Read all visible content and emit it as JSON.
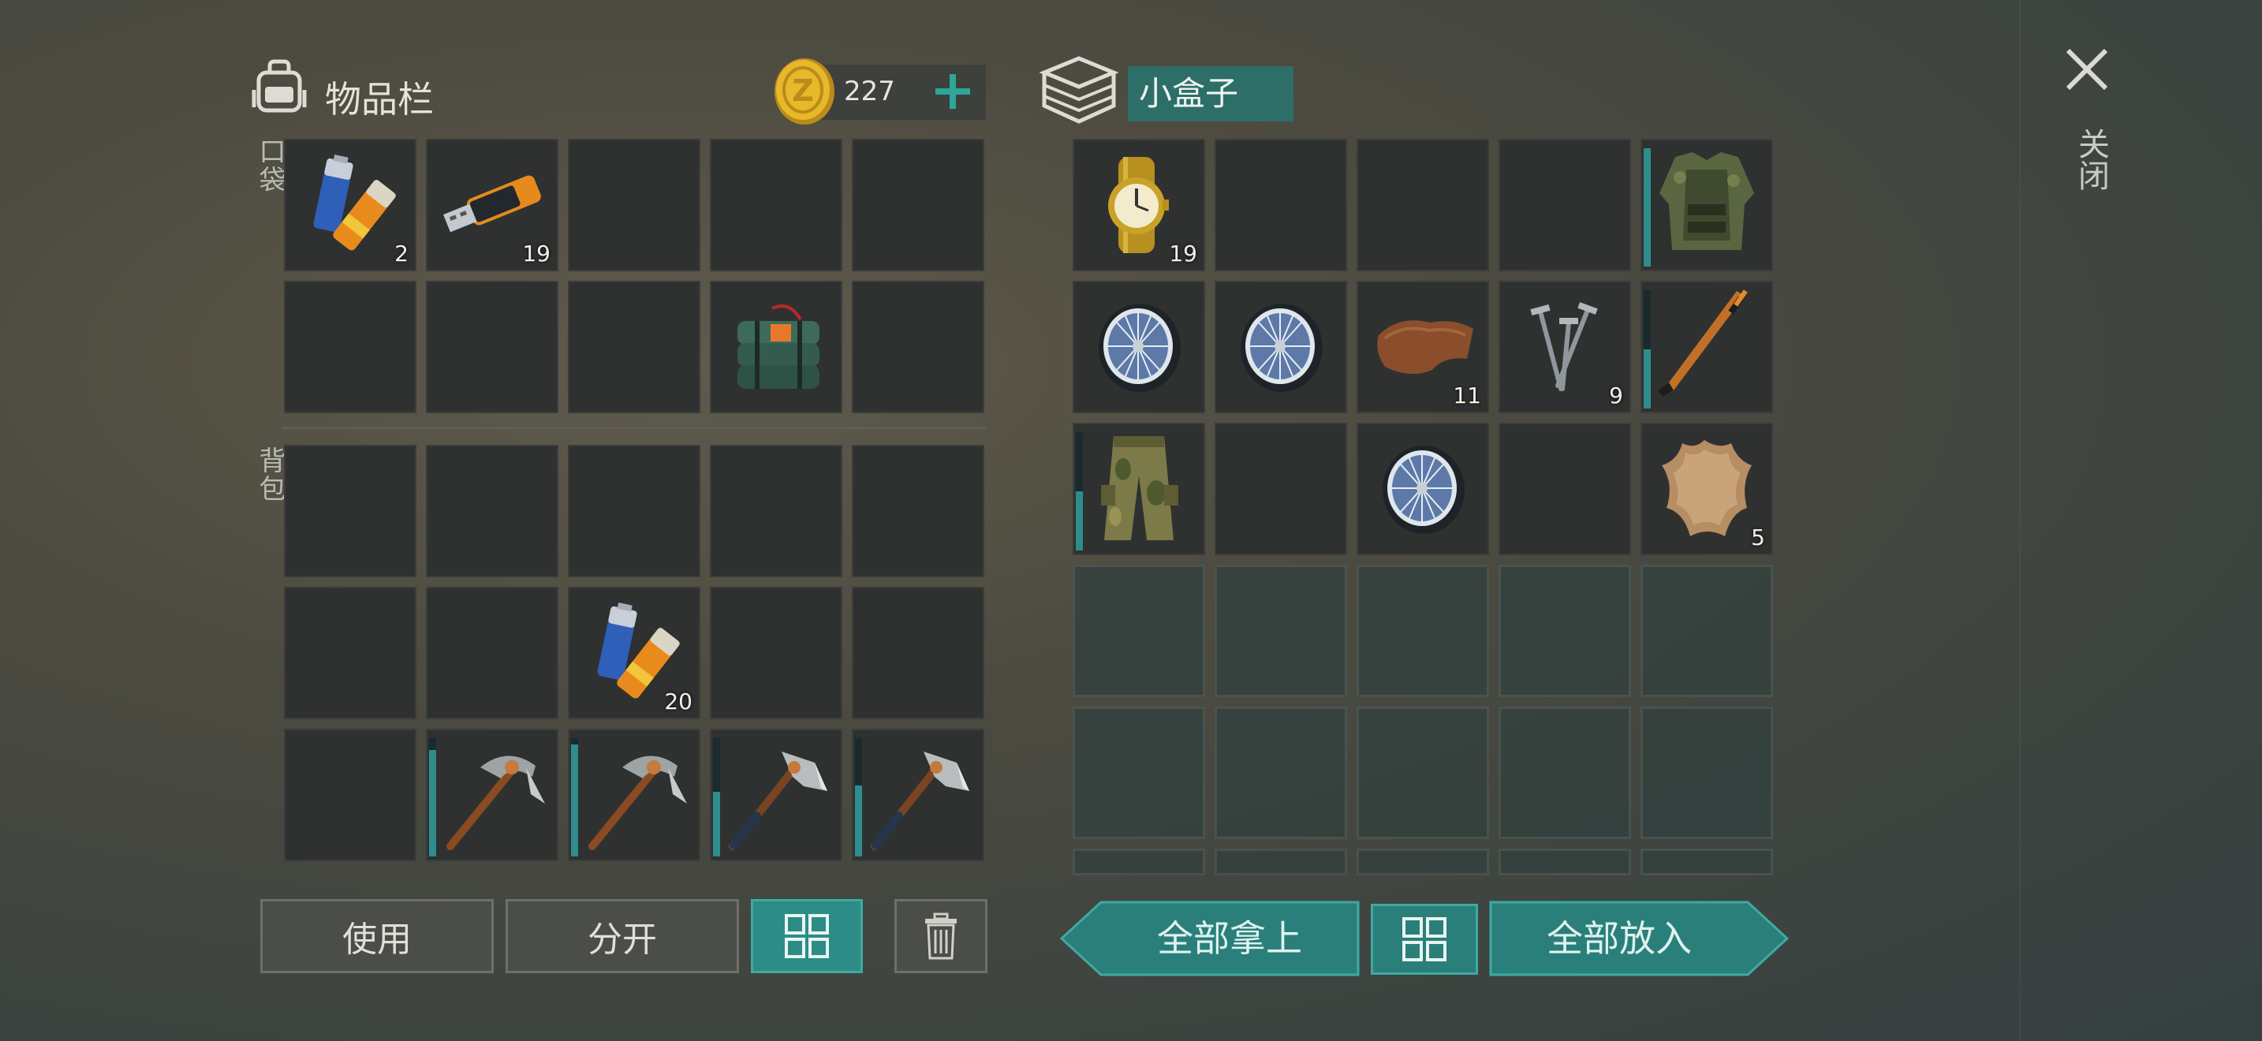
{
  "inventory": {
    "title": "物品栏",
    "coins": "227",
    "section_pockets": "口袋",
    "section_backpack": "背包",
    "pocket_slots": [
      {
        "item": "batteries-icon",
        "count": "2"
      },
      {
        "item": "usb-drive-icon",
        "count": "19"
      },
      {
        "item": "",
        "count": ""
      },
      {
        "item": "",
        "count": ""
      },
      {
        "item": "",
        "count": ""
      },
      {
        "item": "",
        "count": ""
      },
      {
        "item": "",
        "count": ""
      },
      {
        "item": "",
        "count": ""
      },
      {
        "item": "explosive-charge-icon",
        "count": ""
      },
      {
        "item": "",
        "count": ""
      }
    ],
    "backpack_slots": [
      {
        "item": "",
        "count": ""
      },
      {
        "item": "",
        "count": ""
      },
      {
        "item": "",
        "count": ""
      },
      {
        "item": "",
        "count": ""
      },
      {
        "item": "",
        "count": ""
      },
      {
        "item": "",
        "count": ""
      },
      {
        "item": "",
        "count": ""
      },
      {
        "item": "batteries-icon",
        "count": "20"
      },
      {
        "item": "",
        "count": ""
      },
      {
        "item": "",
        "count": ""
      },
      {
        "item": "",
        "count": ""
      },
      {
        "item": "pickaxe-icon",
        "count": "",
        "durability": 0.9
      },
      {
        "item": "pickaxe-icon",
        "count": "",
        "durability": 0.95
      },
      {
        "item": "hatchet-icon",
        "count": "",
        "durability": 0.55
      },
      {
        "item": "hatchet-icon",
        "count": "",
        "durability": 0.6
      }
    ],
    "buttons": {
      "use": "使用",
      "split": "分开"
    }
  },
  "container": {
    "title": "小盒子",
    "slots": [
      {
        "item": "gold-watch-icon",
        "count": "19"
      },
      {
        "item": "",
        "count": ""
      },
      {
        "item": "",
        "count": ""
      },
      {
        "item": "",
        "count": ""
      },
      {
        "item": "tactical-vest-icon",
        "count": "",
        "durability": 1.0
      },
      {
        "item": "bicycle-wheel-icon",
        "count": ""
      },
      {
        "item": "bicycle-wheel-icon",
        "count": ""
      },
      {
        "item": "leather-scrap-icon",
        "count": "11"
      },
      {
        "item": "nails-icon",
        "count": "9"
      },
      {
        "item": "hockey-stick-icon",
        "count": "",
        "durability": 0.5
      },
      {
        "item": "camo-pants-icon",
        "count": "",
        "durability": 0.5
      },
      {
        "item": "",
        "count": ""
      },
      {
        "item": "bicycle-wheel-icon",
        "count": ""
      },
      {
        "item": "",
        "count": ""
      },
      {
        "item": "animal-hide-icon",
        "count": "5"
      }
    ],
    "buttons": {
      "take_all": "全部拿上",
      "put_all": "全部放入"
    }
  },
  "close_label": "关闭",
  "colors": {
    "accent": "#2d8c86",
    "slot": "#2e3130",
    "durability": "#2f8d8d"
  }
}
